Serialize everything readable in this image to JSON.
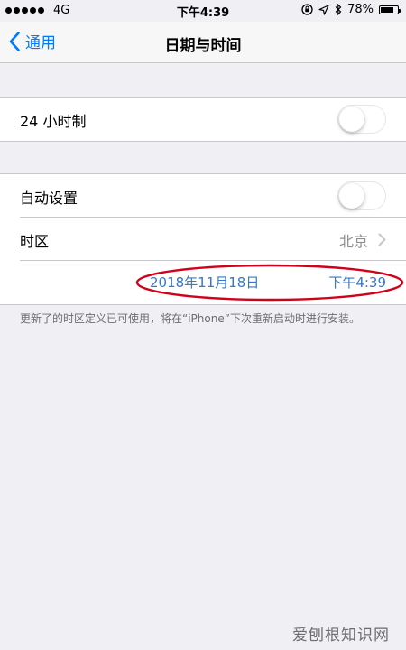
{
  "status_bar": {
    "carrier": "4G",
    "time": "下午4:39",
    "battery": "78%",
    "battery_level": 0.78
  },
  "nav": {
    "back_label": "通用",
    "title": "日期与时间"
  },
  "settings": {
    "clock_24h": {
      "label": "24 小时制",
      "on": false
    },
    "auto_set": {
      "label": "自动设置",
      "on": false
    },
    "time_zone": {
      "label": "时区",
      "value": "北京"
    },
    "date": "2018年11月18日",
    "time": "下午4:39"
  },
  "footnote": "更新了的时区定义已可使用，将在“iPhone”下次重新启动时进行安装。",
  "watermark": "爱刨根知识网",
  "colors": {
    "accent": "#007aff",
    "date_text": "#3478c8",
    "annotation_circle": "#d0021b"
  }
}
